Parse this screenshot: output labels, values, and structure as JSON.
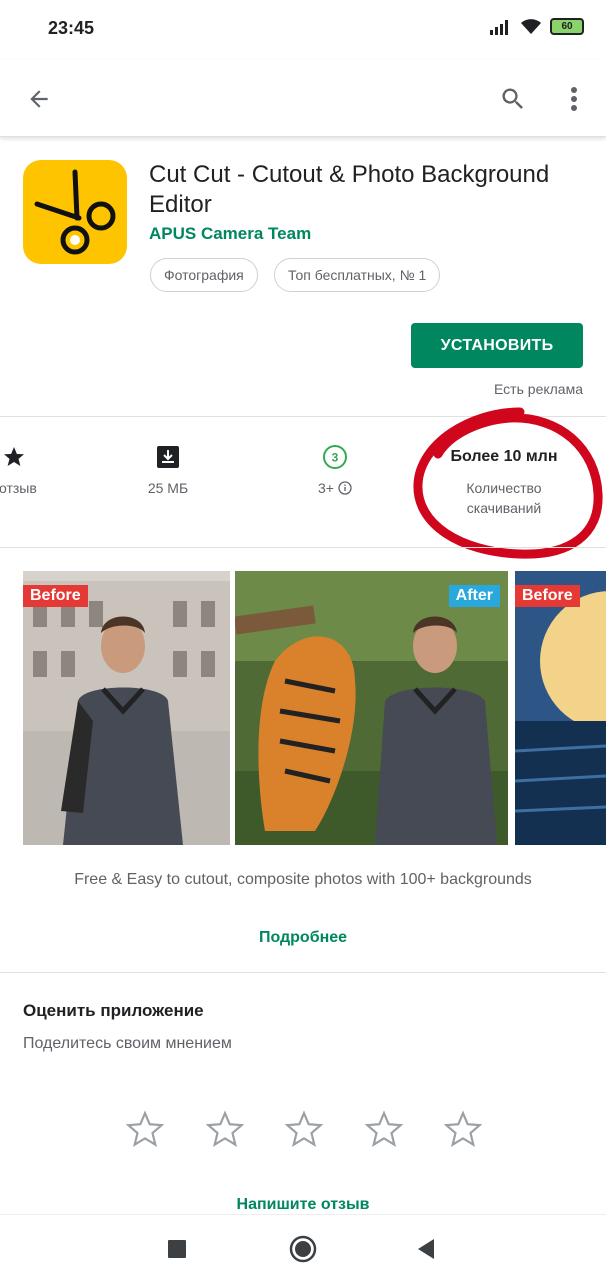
{
  "status": {
    "time": "23:45",
    "battery": "60"
  },
  "app": {
    "title": "Cut Cut - Cutout & Photo Background Editor",
    "developer": "APUS Camera Team",
    "chips": [
      "Фотография",
      "Топ бесплатных, № 1"
    ],
    "install_label": "УСТАНОВИТЬ",
    "ads_note": "Есть реклама"
  },
  "stats": {
    "reviews_label": ". отзыв",
    "size_label": "25 МБ",
    "age_badge": "3",
    "age_label": "3+",
    "downloads_value": "Более 10 млн",
    "downloads_label": "Количество скачиваний"
  },
  "screenshots": {
    "badge_before": "Before",
    "badge_after": "After",
    "badge_before_2": "Before"
  },
  "description": "Free & Easy to cutout, composite photos with 100+ backgrounds",
  "more_label": "Подробнее",
  "rate": {
    "title": "Оценить приложение",
    "subtitle": "Поделитесь своим мнением",
    "review_link": "Напишите отзыв"
  },
  "colors": {
    "accent": "#01875f",
    "annotation": "#d0061c",
    "icon_bg": "#ffc400"
  }
}
